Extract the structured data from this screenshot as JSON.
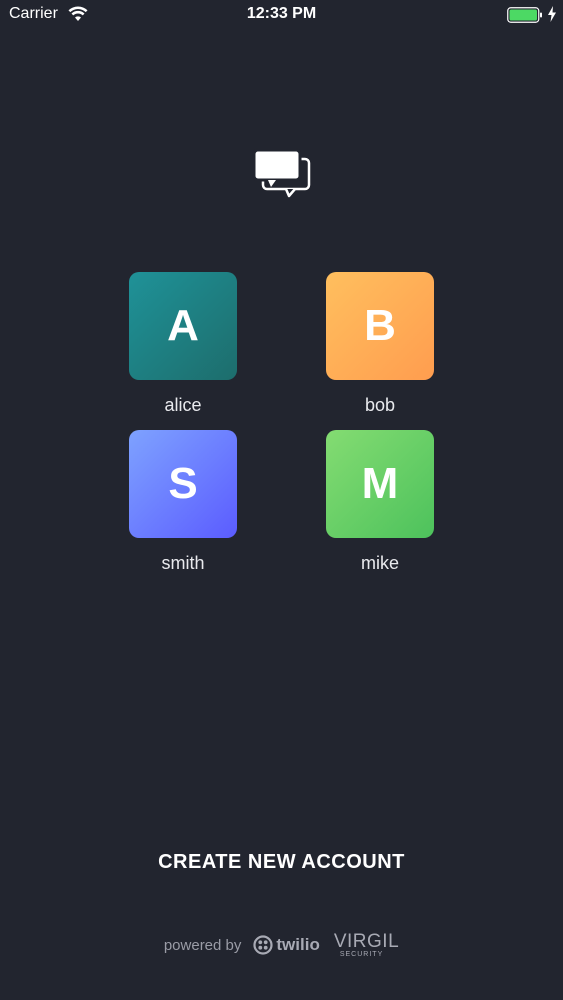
{
  "status_bar": {
    "carrier": "Carrier",
    "time": "12:33 PM",
    "battery_icon": "battery-full-icon",
    "wifi_icon": "wifi-icon"
  },
  "logo": {
    "icon": "chat-bubbles-icon"
  },
  "accounts": [
    {
      "initial": "A",
      "name": "alice",
      "color": "#1e8387"
    },
    {
      "initial": "B",
      "name": "bob",
      "color": "#ffae56"
    },
    {
      "initial": "S",
      "name": "smith",
      "color": "#6d7fff"
    },
    {
      "initial": "M",
      "name": "mike",
      "color": "#6ccf67"
    }
  ],
  "actions": {
    "create_account": "CREATE NEW ACCOUNT"
  },
  "footer": {
    "powered_by": "powered by",
    "twilio": "twilio",
    "virgil": "VIRGIL",
    "virgil_sub": "SECURITY"
  },
  "colors": {
    "background": "#22252f",
    "battery": "#4cd964"
  }
}
